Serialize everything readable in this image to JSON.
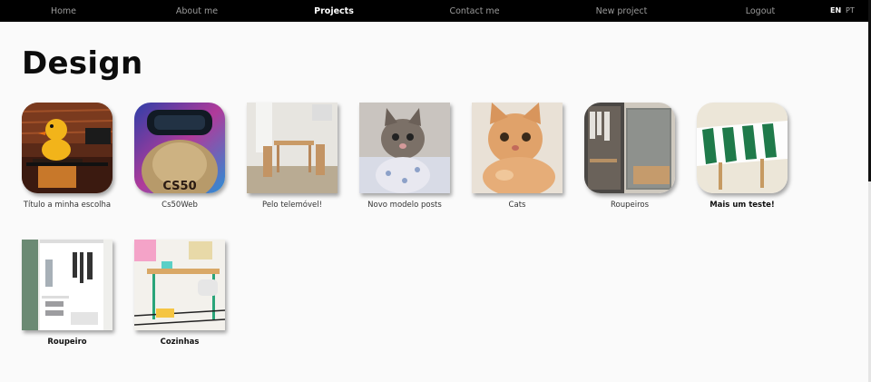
{
  "nav": {
    "items": [
      {
        "label": "Home",
        "active": false
      },
      {
        "label": "About me",
        "active": false
      },
      {
        "label": "Projects",
        "active": true
      },
      {
        "label": "Contact me",
        "active": false
      },
      {
        "label": "New project",
        "active": false
      },
      {
        "label": "Logout",
        "active": false
      }
    ],
    "languages": [
      {
        "label": "EN",
        "active": true
      },
      {
        "label": "PT",
        "active": false
      }
    ]
  },
  "page": {
    "title": "Design"
  },
  "projects": [
    {
      "caption": "Título a minha escolha",
      "bold": false,
      "thumbnail": "duck-desk-icon",
      "rounded": true
    },
    {
      "caption": "Cs50Web",
      "bold": false,
      "thumbnail": "duck-vr-headset-icon",
      "rounded": true
    },
    {
      "caption": "Pelo telemóvel!",
      "bold": false,
      "thumbnail": "dining-table-icon",
      "rounded": false
    },
    {
      "caption": "Novo modelo posts",
      "bold": false,
      "thumbnail": "kitten-icon",
      "rounded": false
    },
    {
      "caption": "Cats",
      "bold": false,
      "thumbnail": "orange-cat-icon",
      "rounded": false
    },
    {
      "caption": "Roupeiros",
      "bold": false,
      "thumbnail": "wardrobe-icon",
      "rounded": true
    },
    {
      "caption": "Mais um teste!",
      "bold": true,
      "thumbnail": "patterned-table-icon",
      "rounded": true
    },
    {
      "caption": "Roupeiro",
      "bold": true,
      "thumbnail": "open-closet-icon",
      "rounded": false
    },
    {
      "caption": "Cozinhas",
      "bold": true,
      "thumbnail": "desk-workspace-icon",
      "rounded": false
    }
  ]
}
